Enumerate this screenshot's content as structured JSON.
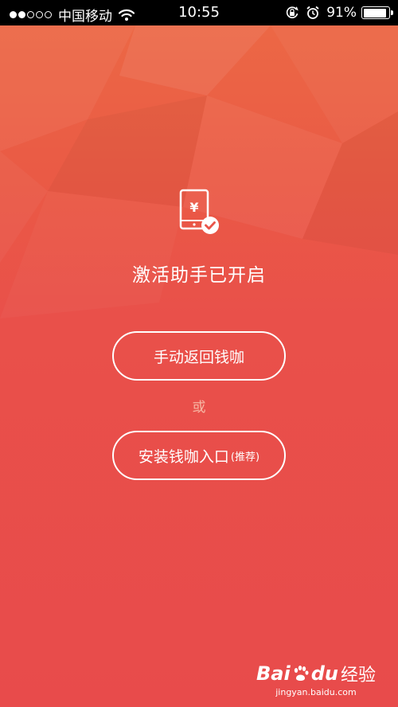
{
  "status_bar": {
    "carrier": "中国移动",
    "time": "10:55",
    "battery_percent": "91%",
    "battery_level": 0.91,
    "signal_bars_filled": 2,
    "signal_bars_total": 5
  },
  "main": {
    "title": "激活助手已开启",
    "icon_symbol": "¥",
    "return_button_label": "手动返回钱咖",
    "or_text": "或",
    "install_button_label": "安装钱咖入口",
    "install_button_sub": "(推荐)"
  },
  "watermark": {
    "brand_left": "Bai",
    "brand_right": "du",
    "product": "经验",
    "url": "jingyan.baidu.com"
  },
  "colors": {
    "bg_top": "#ec6a45",
    "bg_bottom": "#e84b4b",
    "text": "#ffffff"
  }
}
